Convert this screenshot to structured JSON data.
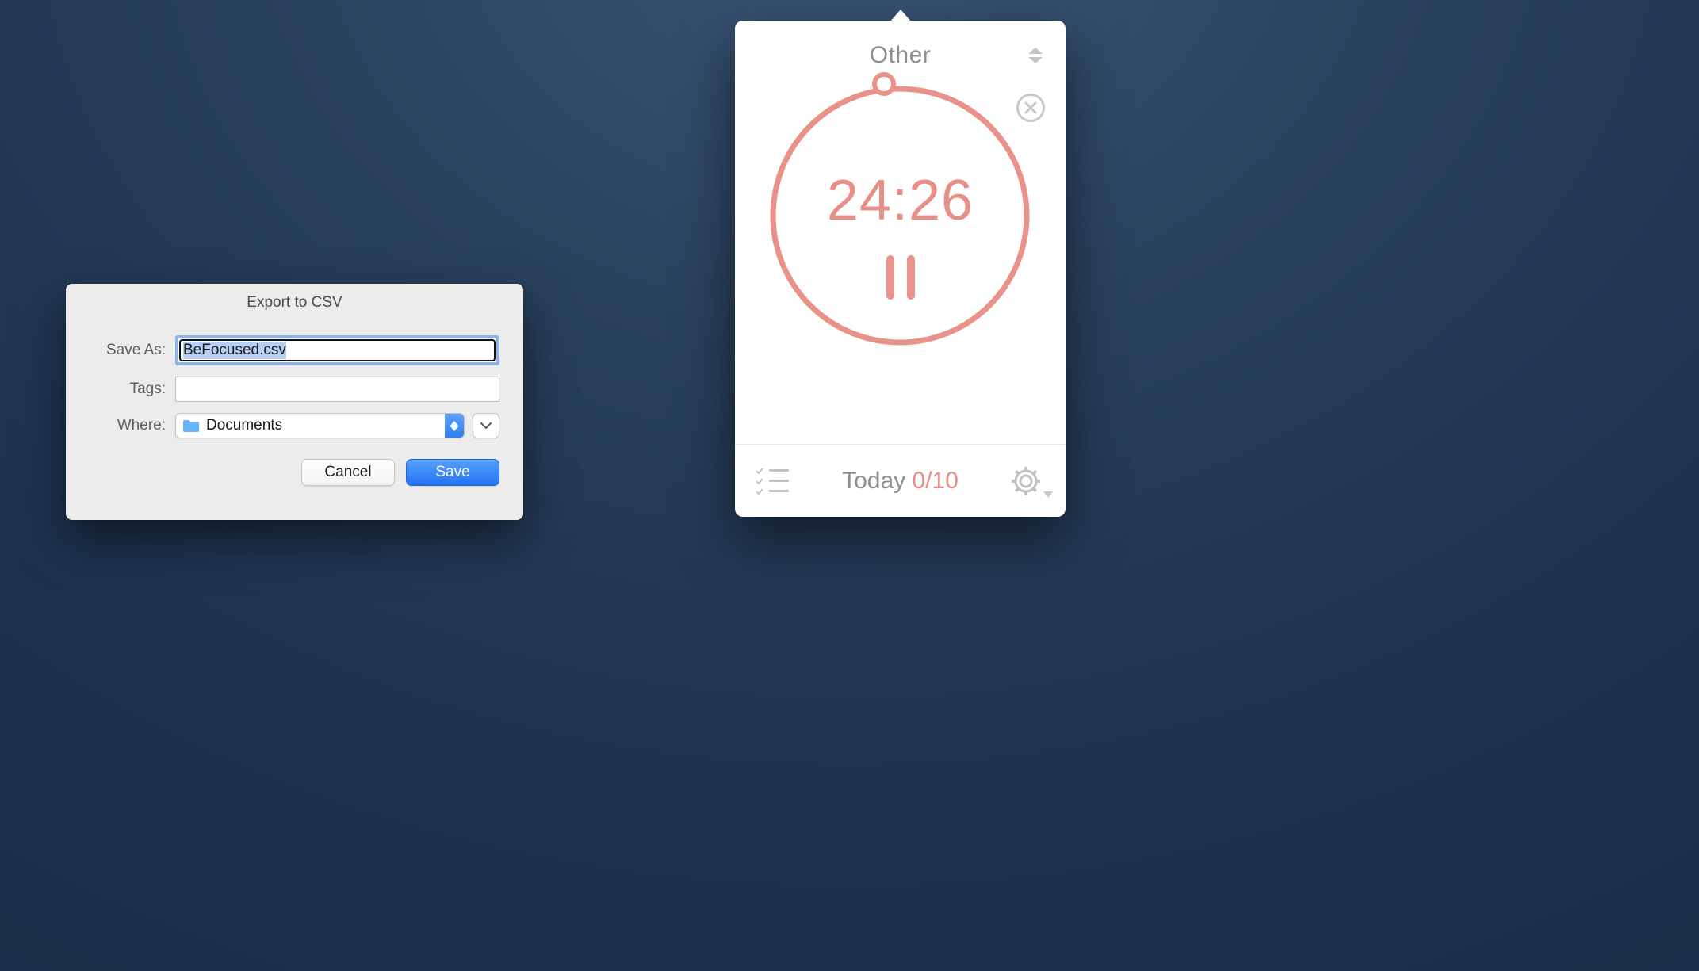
{
  "dialog": {
    "title": "Export to CSV",
    "save_as_label": "Save As:",
    "save_as_value": "BeFocused.csv",
    "tags_label": "Tags:",
    "tags_value": "",
    "where_label": "Where:",
    "where_value": "Documents",
    "cancel_label": "Cancel",
    "save_label": "Save"
  },
  "timer": {
    "category": "Other",
    "time_display": "24:26",
    "today_label": "Today",
    "completed": 0,
    "target": 10,
    "count_display": "0/10",
    "accent_color": "#e78f87"
  }
}
